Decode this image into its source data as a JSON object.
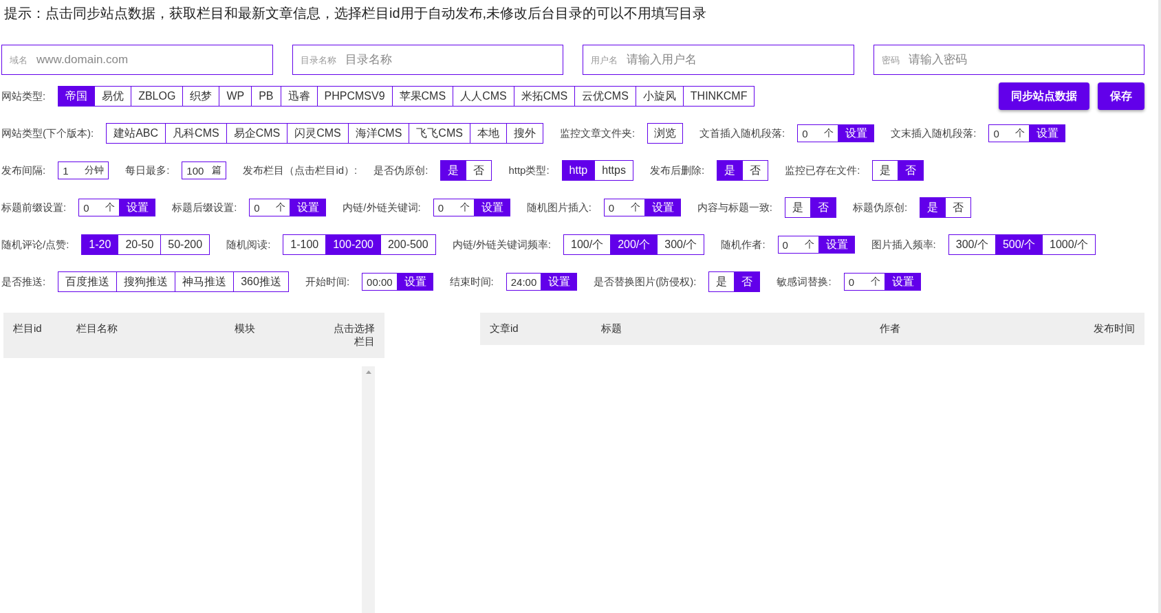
{
  "hint": "提示：点击同步站点数据，获取栏目和最新文章信息，选择栏目id用于自动发布,未修改后台目录的可以不用填写目录",
  "fields": [
    {
      "label": "域名",
      "placeholder": "www.domain.com"
    },
    {
      "label": "目录名称",
      "placeholder": "目录名称"
    },
    {
      "label": "用户名",
      "placeholder": "请输入用户名"
    },
    {
      "label": "密码",
      "placeholder": "请输入密码"
    }
  ],
  "rows": [
    {
      "groups": [
        {
          "label": "网站类型:",
          "control": {
            "kind": "segment",
            "options": [
              {
                "text": "帝国",
                "selected": true
              },
              {
                "text": "易优",
                "selected": false
              },
              {
                "text": "ZBLOG",
                "selected": false
              },
              {
                "text": "织梦",
                "selected": false
              },
              {
                "text": "WP",
                "selected": false
              },
              {
                "text": "PB",
                "selected": false
              },
              {
                "text": "迅睿",
                "selected": false
              },
              {
                "text": "PHPCMSV9",
                "selected": false
              },
              {
                "text": "苹果CMS",
                "selected": false
              },
              {
                "text": "人人CMS",
                "selected": false
              },
              {
                "text": "米拓CMS",
                "selected": false
              },
              {
                "text": "云优CMS",
                "selected": false
              },
              {
                "text": "小旋风",
                "selected": false
              },
              {
                "text": "THINKCMF",
                "selected": false
              }
            ]
          }
        }
      ],
      "actions": [
        "同步站点数据",
        "保存"
      ]
    },
    {
      "groups": [
        {
          "label": "网站类型(下个版本):",
          "control": {
            "kind": "segment",
            "options": [
              {
                "text": "建站ABC",
                "selected": false
              },
              {
                "text": "凡科CMS",
                "selected": false
              },
              {
                "text": "易企CMS",
                "selected": false
              },
              {
                "text": "闪灵CMS",
                "selected": false
              },
              {
                "text": "海洋CMS",
                "selected": false
              },
              {
                "text": "飞飞CMS",
                "selected": false
              },
              {
                "text": "本地",
                "selected": false
              },
              {
                "text": "搜外",
                "selected": false
              }
            ]
          }
        },
        {
          "label": "监控文章文件夹:",
          "control": {
            "kind": "browse",
            "text": "浏览"
          }
        },
        {
          "label": "文首插入随机段落:",
          "control": {
            "kind": "stepper",
            "value": "0",
            "unit": "个",
            "button": "设置"
          }
        },
        {
          "label": "文末插入随机段落:",
          "control": {
            "kind": "stepper",
            "value": "0",
            "unit": "个",
            "button": "设置"
          }
        }
      ]
    },
    {
      "groups": [
        {
          "label": "发布间隔:",
          "control": {
            "kind": "stepper",
            "value": "1",
            "unit": "分钟"
          }
        },
        {
          "label": "每日最多:",
          "control": {
            "kind": "stepper",
            "value": "100",
            "unit": "篇"
          }
        },
        {
          "label": "发布栏目（点击栏目id）:"
        },
        {
          "label": "是否伪原创:",
          "control": {
            "kind": "segment",
            "options": [
              {
                "text": "是",
                "selected": true
              },
              {
                "text": "否",
                "selected": false
              }
            ]
          }
        },
        {
          "label": "http类型:",
          "control": {
            "kind": "segment",
            "options": [
              {
                "text": "http",
                "selected": true
              },
              {
                "text": "https",
                "selected": false
              }
            ]
          }
        },
        {
          "label": "发布后删除:",
          "control": {
            "kind": "segment",
            "options": [
              {
                "text": "是",
                "selected": true
              },
              {
                "text": "否",
                "selected": false
              }
            ]
          }
        },
        {
          "label": "监控已存在文件:",
          "control": {
            "kind": "segment",
            "options": [
              {
                "text": "是",
                "selected": false
              },
              {
                "text": "否",
                "selected": true
              }
            ]
          }
        }
      ]
    },
    {
      "groups": [
        {
          "label": "标题前缀设置:",
          "control": {
            "kind": "stepper",
            "value": "0",
            "unit": "个",
            "button": "设置"
          }
        },
        {
          "label": "标题后缀设置:",
          "control": {
            "kind": "stepper",
            "value": "0",
            "unit": "个",
            "button": "设置"
          }
        },
        {
          "label": "内链/外链关键词:",
          "control": {
            "kind": "stepper",
            "value": "0",
            "unit": "个",
            "button": "设置"
          }
        },
        {
          "label": "随机图片插入:",
          "control": {
            "kind": "stepper",
            "value": "0",
            "unit": "个",
            "button": "设置"
          }
        },
        {
          "label": "内容与标题一致:",
          "control": {
            "kind": "segment",
            "options": [
              {
                "text": "是",
                "selected": false
              },
              {
                "text": "否",
                "selected": true
              }
            ]
          }
        },
        {
          "label": "标题伪原创:",
          "control": {
            "kind": "segment",
            "options": [
              {
                "text": "是",
                "selected": true
              },
              {
                "text": "否",
                "selected": false
              }
            ]
          }
        }
      ]
    },
    {
      "groups": [
        {
          "label": "随机评论/点赞:",
          "control": {
            "kind": "segment",
            "options": [
              {
                "text": "1-20",
                "selected": true
              },
              {
                "text": "20-50",
                "selected": false
              },
              {
                "text": "50-200",
                "selected": false
              }
            ]
          }
        },
        {
          "label": "随机阅读:",
          "control": {
            "kind": "segment",
            "options": [
              {
                "text": "1-100",
                "selected": false
              },
              {
                "text": "100-200",
                "selected": true
              },
              {
                "text": "200-500",
                "selected": false
              }
            ]
          }
        },
        {
          "label": "内链/外链关键词频率:",
          "control": {
            "kind": "segment",
            "options": [
              {
                "text": "100/个",
                "selected": false
              },
              {
                "text": "200/个",
                "selected": true
              },
              {
                "text": "300/个",
                "selected": false
              }
            ]
          }
        },
        {
          "label": "随机作者:",
          "control": {
            "kind": "stepper",
            "value": "0",
            "unit": "个",
            "button": "设置"
          }
        },
        {
          "label": "图片插入频率:",
          "control": {
            "kind": "segment",
            "options": [
              {
                "text": "300/个",
                "selected": false
              },
              {
                "text": "500/个",
                "selected": true
              },
              {
                "text": "1000/个",
                "selected": false
              }
            ]
          }
        }
      ]
    },
    {
      "groups": [
        {
          "label": "是否推送:",
          "control": {
            "kind": "segment",
            "options": [
              {
                "text": "百度推送",
                "selected": false
              },
              {
                "text": "搜狗推送",
                "selected": false
              },
              {
                "text": "神马推送",
                "selected": false
              },
              {
                "text": "360推送",
                "selected": false
              }
            ]
          }
        },
        {
          "label": "开始时间:",
          "control": {
            "kind": "stepper",
            "value": "00:00",
            "button": "设置"
          }
        },
        {
          "label": "结束时间:",
          "control": {
            "kind": "stepper",
            "value": "24:00",
            "button": "设置"
          }
        },
        {
          "label": "是否替换图片(防侵权):",
          "control": {
            "kind": "segment",
            "options": [
              {
                "text": "是",
                "selected": false
              },
              {
                "text": "否",
                "selected": true
              }
            ]
          }
        },
        {
          "label": "敏感词替换:",
          "control": {
            "kind": "stepper",
            "value": "0",
            "unit": "个",
            "button": "设置"
          }
        }
      ]
    }
  ],
  "category_table": {
    "columns": [
      "栏目id",
      "栏目名称",
      "模块",
      "点击选择栏目"
    ]
  },
  "article_table": {
    "columns": [
      "文章id",
      "标题",
      "作者",
      "发布时间"
    ]
  }
}
